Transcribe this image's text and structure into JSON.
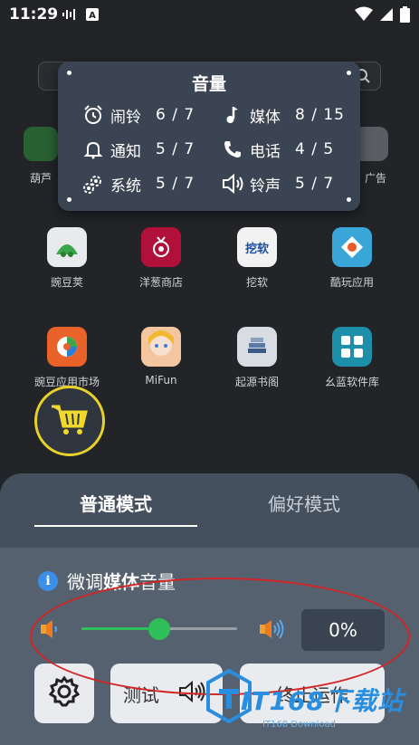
{
  "status_bar": {
    "time": "11:29",
    "left_icons": [
      "audio-wave-icon",
      "a-letter-icon"
    ],
    "right_icons": [
      "wifi-icon",
      "signal-icon",
      "battery-icon"
    ]
  },
  "launcher": {
    "apps": [
      {
        "label": "豌豆荚",
        "icon": "wandoujia-icon",
        "color": "#e8eaee"
      },
      {
        "label": "洋葱商店",
        "icon": "onion-store-icon",
        "color": "#b0103a"
      },
      {
        "label": "挖软",
        "icon": "waruan-icon",
        "color": "#f2f2f2",
        "icon_text": "挖软"
      },
      {
        "label": "酷玩应用",
        "icon": "kuwan-icon",
        "color": "#3aa6d8"
      },
      {
        "label": "豌豆应用市场",
        "icon": "wandou-market-icon",
        "color": "#e8622a"
      },
      {
        "label": "MiFun",
        "icon": "mifun-icon",
        "color": "#f2d8c8"
      },
      {
        "label": "起源书阁",
        "icon": "book-icon",
        "color": "#d8dde4"
      },
      {
        "label": "幺蓝软件库",
        "icon": "yaolan-icon",
        "color": "#1d8fa8"
      }
    ],
    "partial_labels": {
      "left": "葫芦",
      "right": "广告"
    }
  },
  "volume_panel": {
    "title": "音量",
    "items": [
      {
        "label": "闹铃",
        "value": "6 / 7",
        "icon": "alarm-clock-icon"
      },
      {
        "label": "媒体",
        "value": "8 / 15",
        "icon": "music-note-icon"
      },
      {
        "label": "通知",
        "value": "5 / 7",
        "icon": "bell-icon"
      },
      {
        "label": "电话",
        "value": "4 / 5",
        "icon": "phone-icon"
      },
      {
        "label": "系统",
        "value": "5 / 7",
        "icon": "gears-icon"
      },
      {
        "label": "铃声",
        "value": "5 / 7",
        "icon": "speaker-icon"
      }
    ]
  },
  "sheet": {
    "tabs": {
      "normal": "普通模式",
      "preference": "偏好模式"
    },
    "fine_tune_prefix": "微调",
    "fine_tune_target": "媒体",
    "fine_tune_suffix": "音量",
    "slider_level": 0.5,
    "percent": "0%",
    "test_label": "测试",
    "stop_label": "终止运作"
  },
  "colors": {
    "accent_green": "#2fbf5a",
    "info_blue": "#3b8fe8",
    "basket_yellow": "#e8d22a",
    "annotation_red": "#d22424"
  },
  "watermark": {
    "main": "IT168下载站",
    "sub": "IT168 Download"
  }
}
